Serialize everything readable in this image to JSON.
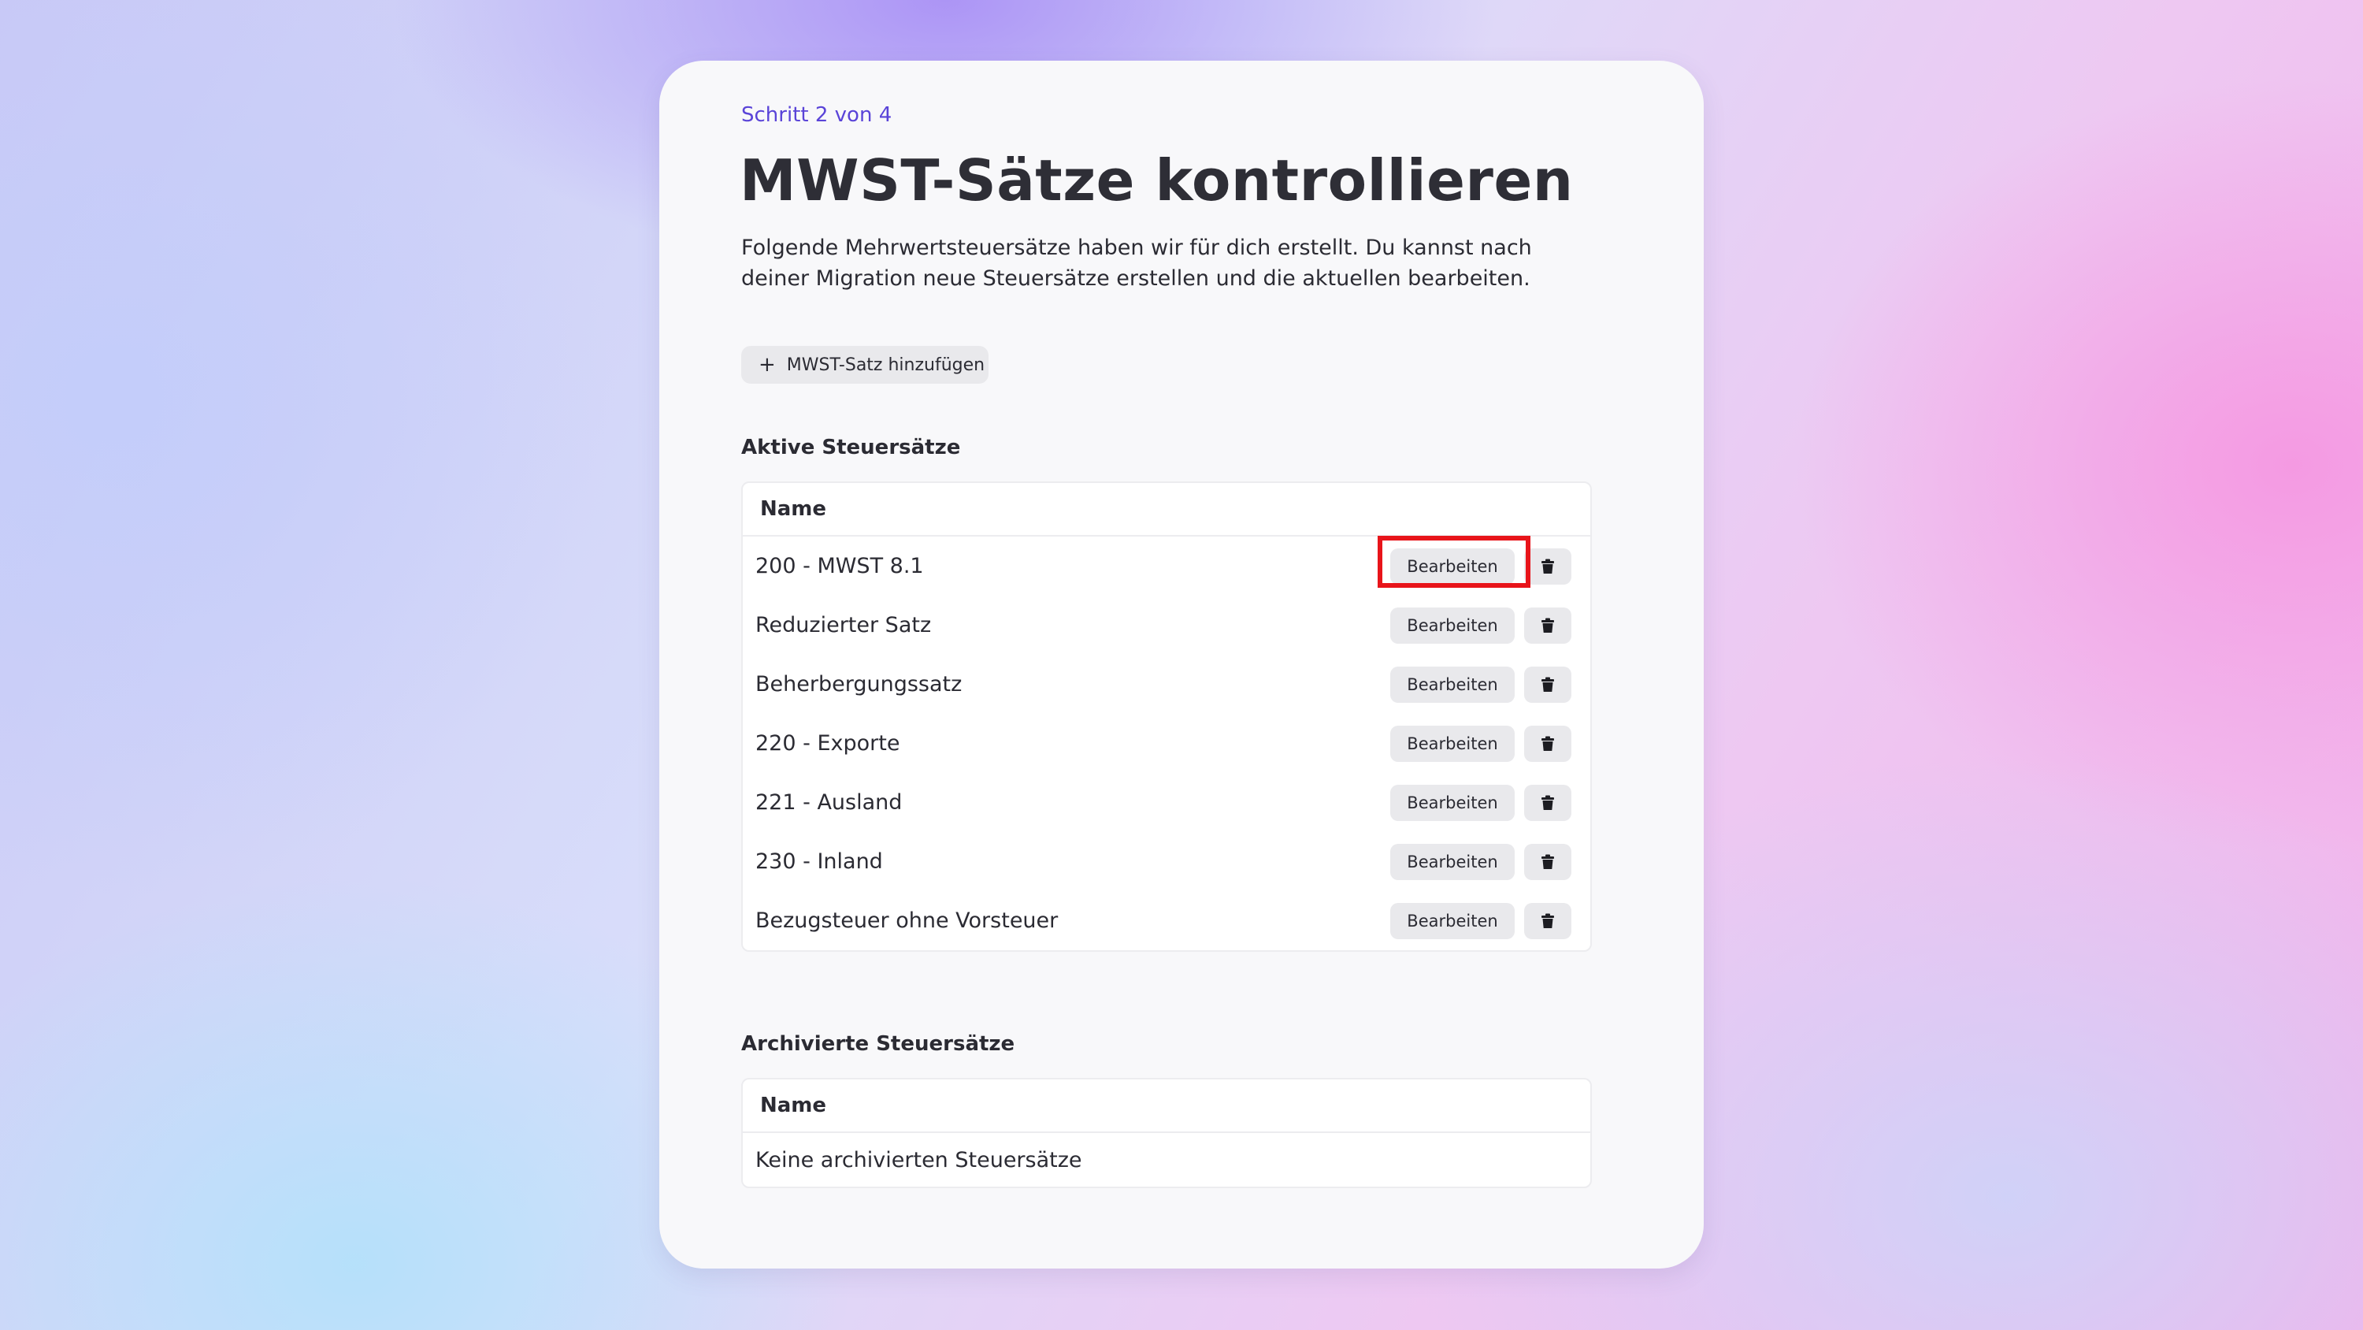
{
  "step_label": "Schritt 2 von 4",
  "title": "MWST-Sätze kontrollieren",
  "description": "Folgende Mehrwertsteuersätze haben wir für dich erstellt. Du kannst nach deiner Migration neue Steuersätze erstellen und die aktuellen bearbeiten.",
  "add_button": {
    "icon": "plus-icon",
    "label": "MWST-Satz hinzufügen"
  },
  "active_section": {
    "title": "Aktive Steuersätze",
    "column_header": "Name",
    "edit_label": "Bearbeiten",
    "delete_icon": "trash-icon",
    "rows": [
      {
        "name": "200 - MWST 8.1",
        "highlighted": true
      },
      {
        "name": "Reduzierter Satz"
      },
      {
        "name": "Beherbergungssatz"
      },
      {
        "name": "220 - Exporte"
      },
      {
        "name": "221 - Ausland"
      },
      {
        "name": "230 - Inland"
      },
      {
        "name": "Bezugsteuer ohne Vorsteuer"
      }
    ]
  },
  "archived_section": {
    "title": "Archivierte Steuersätze",
    "column_header": "Name",
    "empty_text": "Keine archivierten Steuersätze"
  },
  "colors": {
    "accent": "#5a44d8",
    "highlight": "#e8141a",
    "button_bg": "#e9e9ec",
    "card_bg": "#f8f8fa"
  }
}
